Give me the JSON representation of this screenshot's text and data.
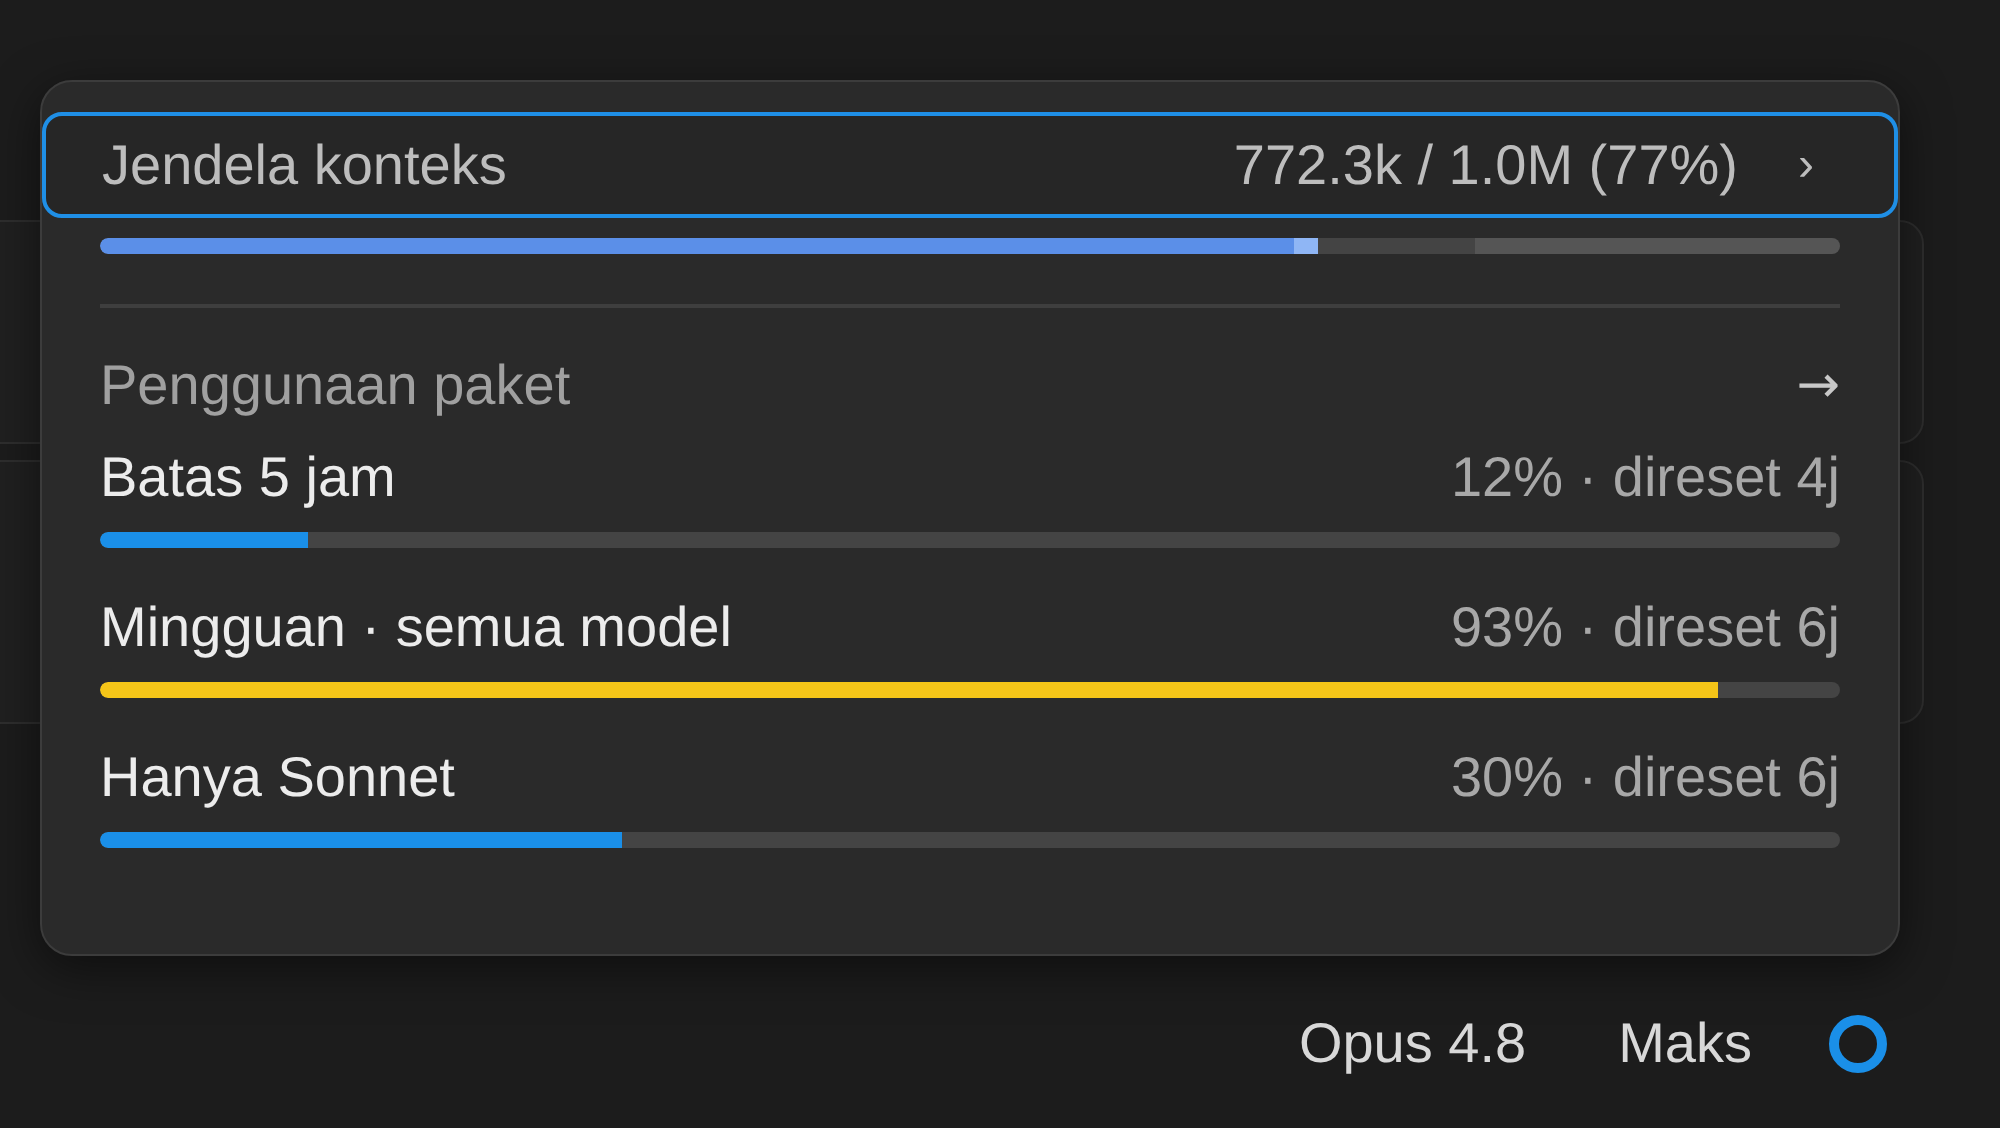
{
  "context": {
    "label": "Jendela konteks",
    "reading": "772.3k / 1.0M (77%)",
    "chevron": "›",
    "level": 0.7
  },
  "plan_usage": {
    "title": "Penggunaan paket",
    "arrow": "→",
    "limits": [
      {
        "label": "Batas 5 jam",
        "reading": "12% · direset 4j",
        "level": 0.12,
        "color": "#1a8fe8"
      },
      {
        "label": "Mingguan · semua model",
        "reading": "93% · direset 6j",
        "level": 0.93,
        "color": "#f5c518"
      },
      {
        "label": "Hanya Sonnet",
        "reading": "30% · direset 6j",
        "level": 0.3,
        "color": "#1a8fe8"
      }
    ]
  },
  "footer": {
    "model": "Opus 4.8",
    "effort": "Maks"
  }
}
